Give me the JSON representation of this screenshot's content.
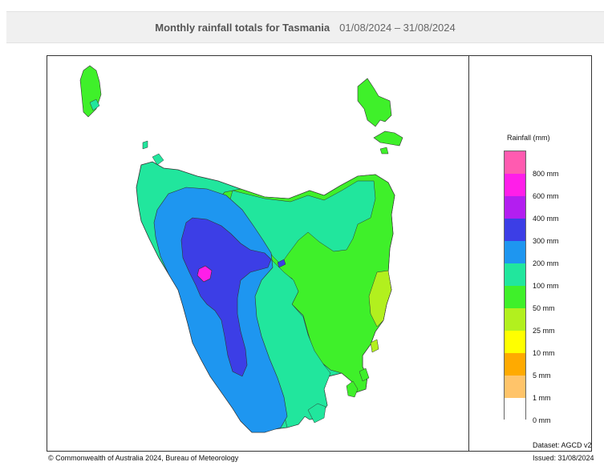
{
  "header": {
    "title": "Monthly rainfall totals for Tasmania",
    "dates": "01/08/2024 – 31/08/2024"
  },
  "legend": {
    "title": "Rainfall (mm)",
    "classes": [
      {
        "label": "",
        "color": "#ff5bb0"
      },
      {
        "label": "800 mm",
        "color": "#ff1ee9"
      },
      {
        "label": "600 mm",
        "color": "#b31ef0"
      },
      {
        "label": "400 mm",
        "color": "#3c3ee6"
      },
      {
        "label": "300 mm",
        "color": "#1e96f0"
      },
      {
        "label": "200 mm",
        "color": "#21e69d"
      },
      {
        "label": "100 mm",
        "color": "#3ff02a"
      },
      {
        "label": "50 mm",
        "color": "#b2f01e"
      },
      {
        "label": "25 mm",
        "color": "#ffff00"
      },
      {
        "label": "10 mm",
        "color": "#ffaa00"
      },
      {
        "label": "5 mm",
        "color": "#ffc46a"
      },
      {
        "label": "1 mm",
        "color": "#ffffff"
      }
    ],
    "bottom_label": "0 mm"
  },
  "footer": {
    "dataset": "Dataset: AGCD v2",
    "copyright": "© Commonwealth of Australia 2024, Bureau of Meteorology",
    "issued": "Issued: 31/08/2024"
  }
}
